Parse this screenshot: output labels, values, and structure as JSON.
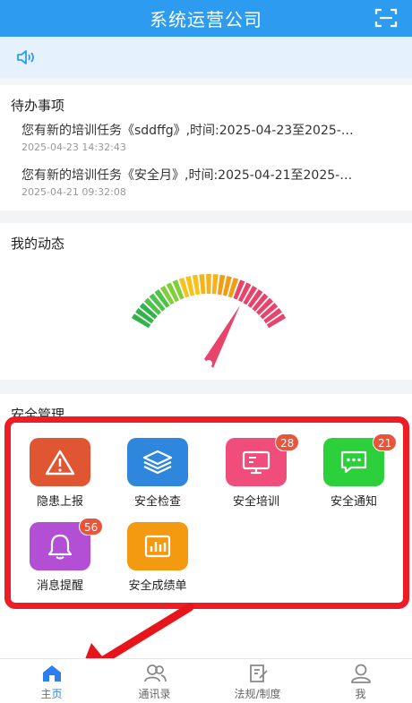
{
  "header": {
    "title": "系统运营公司",
    "scan_icon": "scan-icon"
  },
  "notice": {
    "icon": "speaker-icon"
  },
  "todo": {
    "title": "待办事项",
    "items": [
      {
        "text": "您有新的培训任务《sddffg》,时间:2025-04-23至2025-…",
        "time": "2025-04-23 14:32:43"
      },
      {
        "text": "您有新的培训任务《安全月》,时间:2025-04-21至2025-…",
        "time": "2025-04-21 09:32:08"
      }
    ]
  },
  "dynamic": {
    "title": "我的动态",
    "gauge_icon": "gauge-meter"
  },
  "safety": {
    "title": "安全管理",
    "items": [
      {
        "label": "隐患上报",
        "icon": "warning-icon",
        "color": "#e05532",
        "badge": ""
      },
      {
        "label": "安全检查",
        "icon": "layers-icon",
        "color": "#2f86dd",
        "badge": ""
      },
      {
        "label": "安全培训",
        "icon": "monitor-icon",
        "color": "#f14d7a",
        "badge": "28"
      },
      {
        "label": "安全通知",
        "icon": "chat-icon",
        "color": "#2bd03a",
        "badge": "21"
      },
      {
        "label": "消息提醒",
        "icon": "bell-icon",
        "color": "#b34fd4",
        "badge": "56"
      },
      {
        "label": "安全成绩单",
        "icon": "chart-icon",
        "color": "#f39a10",
        "badge": ""
      }
    ]
  },
  "tabbar": {
    "items": [
      {
        "label": "主页",
        "icon": "home-icon",
        "active": true
      },
      {
        "label": "通讯录",
        "icon": "contacts-icon",
        "active": false
      },
      {
        "label": "法规/制度",
        "icon": "document-icon",
        "active": false
      },
      {
        "label": "我",
        "icon": "user-icon",
        "active": false
      }
    ]
  },
  "colors": {
    "primary": "#2d9cf0",
    "highlight": "#ee1c25",
    "tab_active": "#2d7ff0"
  }
}
